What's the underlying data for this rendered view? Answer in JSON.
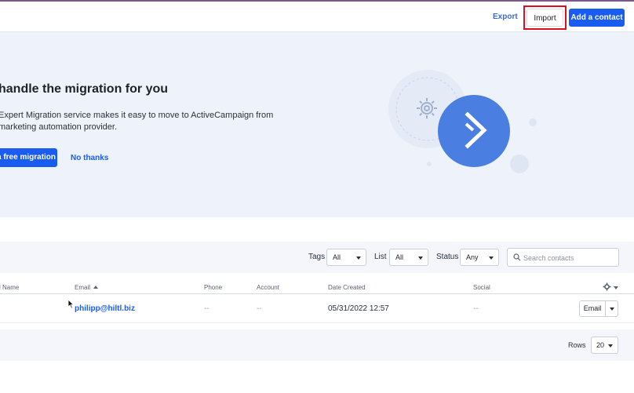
{
  "header": {
    "export_label": "Export",
    "import_label": "Import",
    "add_contact_label": "Add a contact"
  },
  "banner": {
    "title": "handle the migration for you",
    "line1": "Expert Migration service makes it easy to move to ActiveCampaign from",
    "line2": "marketing automation provider.",
    "cta_label": "a free migration",
    "decline_label": "No thanks"
  },
  "filters": {
    "tags_label": "Tags",
    "tags_value": "All",
    "list_label": "List",
    "list_value": "All",
    "status_label": "Status",
    "status_value": "Any",
    "search_placeholder": "Search contacts"
  },
  "table": {
    "columns": {
      "name": "l Name",
      "email": "Email",
      "phone": "Phone",
      "account": "Account",
      "date_created": "Date Created",
      "social": "Social"
    },
    "rows": [
      {
        "email": "philipp@hiltl.biz",
        "phone": "--",
        "account": "--",
        "date_created": "05/31/2022 12:57",
        "social": "--",
        "action_label": "Email"
      }
    ]
  },
  "pagination": {
    "rows_label": "Rows",
    "rows_value": "20"
  },
  "colors": {
    "accent": "#1a5cf0",
    "banner_bg": "#eef3fb",
    "highlight_border": "#d90f25"
  }
}
